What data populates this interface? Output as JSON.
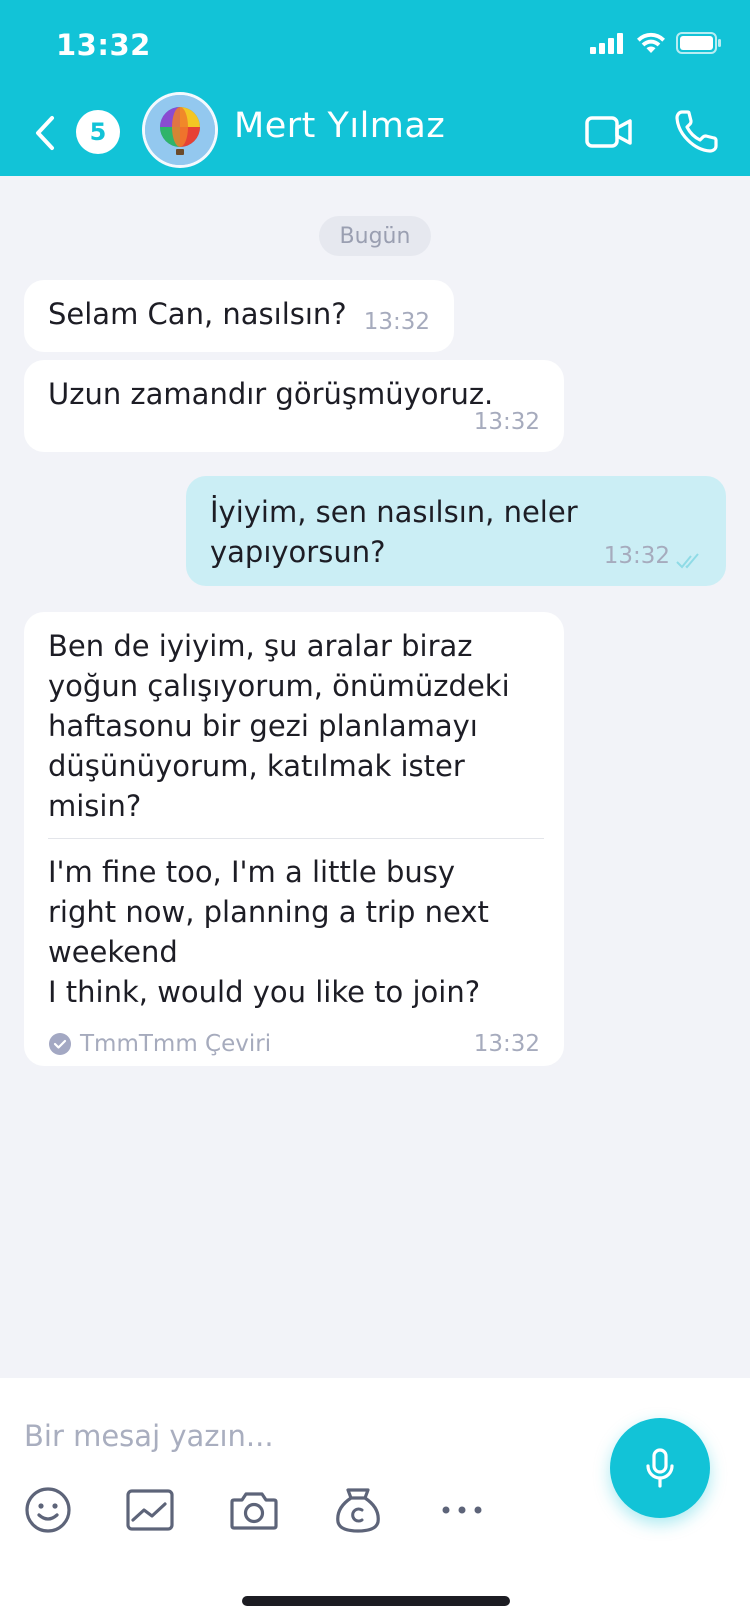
{
  "status_bar": {
    "time": "13:32"
  },
  "header": {
    "unread_count": "5",
    "contact_name": "Mert Yılmaz"
  },
  "chat": {
    "date_label": "Bugün",
    "messages": [
      {
        "direction": "in",
        "text": "Selam Can, nasılsın?",
        "time": "13:32"
      },
      {
        "direction": "in",
        "text": "Uzun zamandır görüşmüyoruz.",
        "time": "13:32"
      },
      {
        "direction": "out",
        "text": "İyiyim, sen nasılsın, neler yapıyorsun?",
        "time": "13:32",
        "read": true
      },
      {
        "direction": "in",
        "text": "Ben de iyiyim, şu aralar biraz yoğun çalışıyorum, önümüzdeki haftasonu bir gezi planlamayı düşünüyorum, katılmak ister misin?",
        "translation": "I'm fine too, I'm a little busy right now, planning a trip next weekend\nI think, would you like to join?",
        "translation_source": "TmmTmm Çeviri",
        "time": "13:32"
      }
    ]
  },
  "composer": {
    "placeholder": "Bir mesaj yazın...",
    "tools": [
      "emoji-icon",
      "gallery-icon",
      "camera-icon",
      "money-bag-icon",
      "more-icon"
    ],
    "mic_icon": "microphone-icon"
  },
  "colors": {
    "accent": "#12c3d7",
    "background": "#f2f3f8",
    "outgoing_bubble": "#cbeef5",
    "incoming_bubble": "#ffffff"
  }
}
